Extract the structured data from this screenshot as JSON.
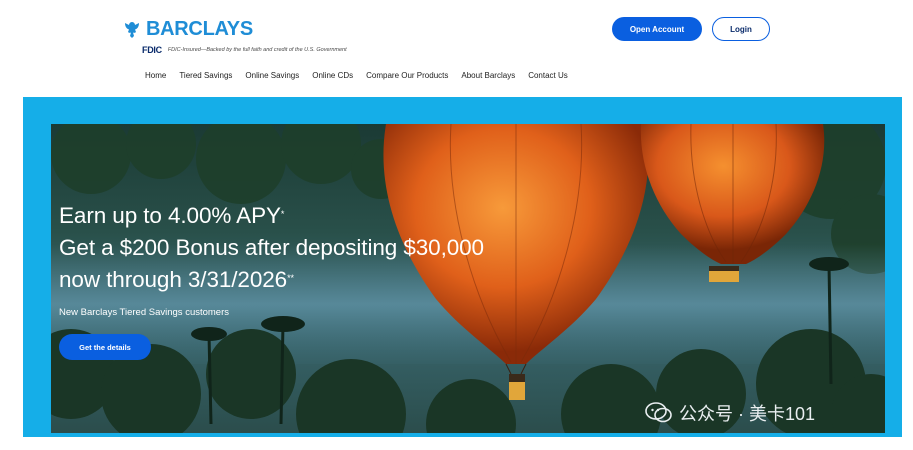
{
  "header": {
    "brand": "BARCLAYS",
    "fdic_logo": "FDIC",
    "fdic_text": "FDIC-Insured—Backed by the full faith and credit of the U.S. Government",
    "open_account": "Open Account",
    "login": "Login"
  },
  "nav": {
    "items": [
      "Home",
      "Tiered Savings",
      "Online Savings",
      "Online CDs",
      "Compare Our Products",
      "About Barclays",
      "Contact Us"
    ]
  },
  "hero": {
    "line1": "Earn up to 4.00% APY",
    "line1_mark": "*",
    "line2": "Get a $200 Bonus after depositing $30,000",
    "line3": "now through 3/31/2026",
    "line3_mark": "**",
    "sub": "New Barclays Tiered Savings customers",
    "cta": "Get the details"
  },
  "watermark": {
    "text": "公众号 · 美卡101"
  },
  "colors": {
    "brand_blue": "#1f8dd6",
    "button_blue": "#0a5fe0",
    "banner_blue": "#15aee8"
  }
}
